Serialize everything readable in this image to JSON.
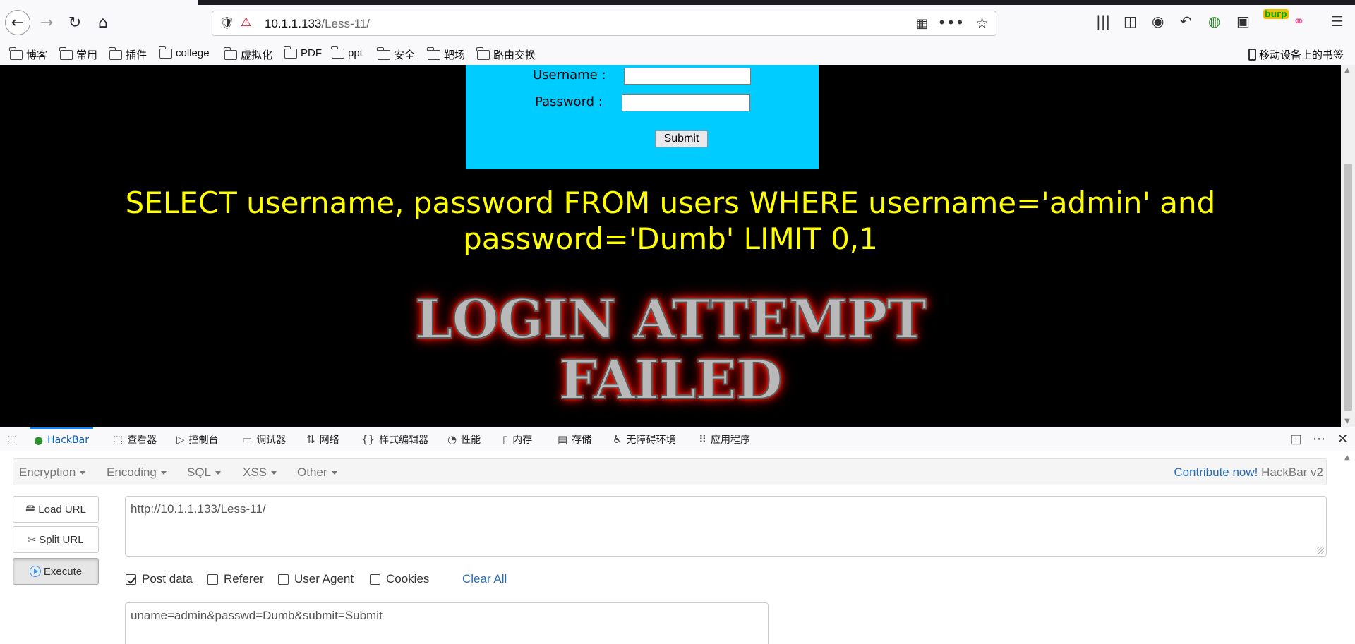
{
  "browser": {
    "url_host": "10.1.1.133",
    "url_path": "/Less-11/",
    "bookmarks": [
      "博客",
      "常用",
      "插件",
      "college",
      "虚拟化",
      "PDF",
      "ppt",
      "安全",
      "靶场",
      "路由交换"
    ],
    "mobile_bookmarks": "移动设备上的书签",
    "burp_badge": "burp"
  },
  "page": {
    "username_label": "Username :",
    "password_label": "Password :",
    "submit_label": "Submit",
    "sql_query": "SELECT username, password FROM users WHERE username='admin' and password='Dumb' LIMIT 0,1",
    "fail_line1": "LOGIN ATTEMPT",
    "fail_line2": "FAILED"
  },
  "devtools": {
    "tabs": [
      "HackBar",
      "查看器",
      "控制台",
      "调试器",
      "网络",
      "样式编辑器",
      "性能",
      "内存",
      "存储",
      "无障碍环境",
      "应用程序"
    ],
    "active_tab": "HackBar"
  },
  "hackbar": {
    "menu": [
      "Encryption",
      "Encoding",
      "SQL",
      "XSS",
      "Other"
    ],
    "contribute_link": "Contribute now!",
    "version": "HackBar v2",
    "load_url": "Load URL",
    "split_url": "Split URL",
    "execute": "Execute",
    "url_value": "http://10.1.1.133/Less-11/",
    "options": [
      {
        "label": "Post data",
        "checked": true
      },
      {
        "label": "Referer",
        "checked": false
      },
      {
        "label": "User Agent",
        "checked": false
      },
      {
        "label": "Cookies",
        "checked": false
      }
    ],
    "clear_all": "Clear All",
    "post_value": "uname=admin&passwd=Dumb&submit=Submit"
  }
}
